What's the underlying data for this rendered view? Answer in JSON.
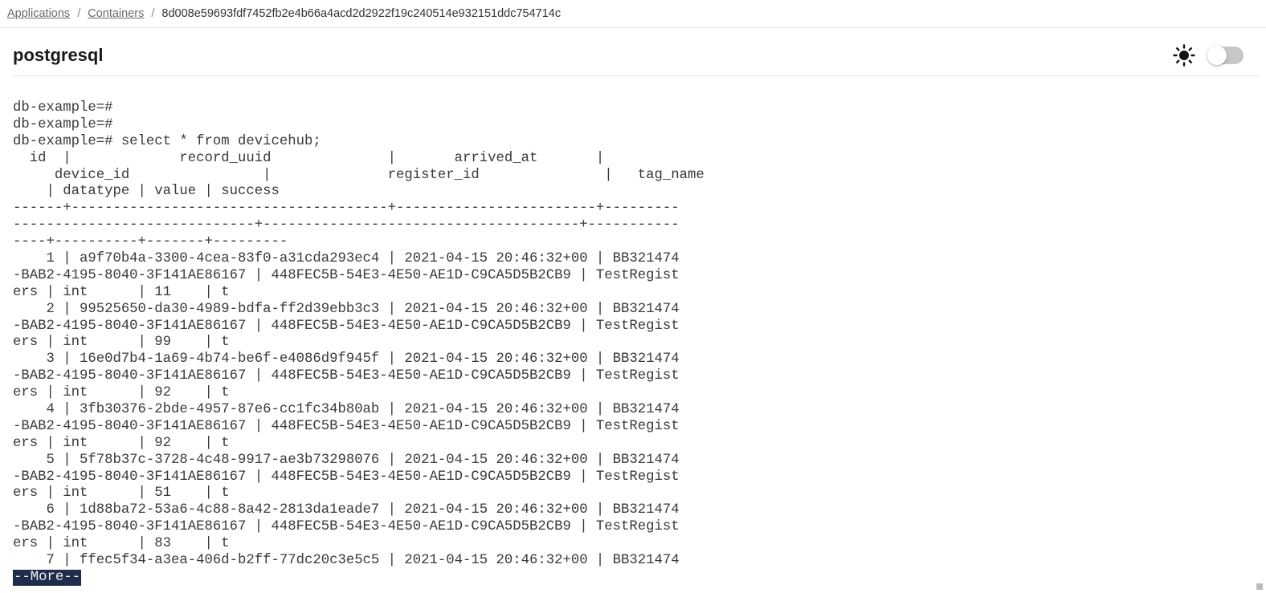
{
  "breadcrumb": {
    "items": [
      {
        "label": "Applications"
      },
      {
        "label": "Containers"
      }
    ],
    "current": "8d008e59693fdf7452fb2e4b66a4acd2d2922f19c240514e932151ddc754714c",
    "separator": "/"
  },
  "header": {
    "title": "postgresql",
    "theme_icon": "sun-icon",
    "theme_toggle_on": false
  },
  "terminal": {
    "lines": [
      "db-example=#",
      "db-example=#",
      "db-example=# select * from devicehub;",
      "  id  |             record_uuid              |       arrived_at       |",
      "     device_id                |              register_id               |   tag_name",
      "    | datatype | value | success",
      "------+--------------------------------------+------------------------+---------",
      "-----------------------------+--------------------------------------+-----------",
      "----+----------+-------+---------",
      "    1 | a9f70b4a-3300-4cea-83f0-a31cda293ec4 | 2021-04-15 20:46:32+00 | BB321474",
      "-BAB2-4195-8040-3F141AE86167 | 448FEC5B-54E3-4E50-AE1D-C9CA5D5B2CB9 | TestRegist",
      "ers | int      | 11    | t",
      "    2 | 99525650-da30-4989-bdfa-ff2d39ebb3c3 | 2021-04-15 20:46:32+00 | BB321474",
      "-BAB2-4195-8040-3F141AE86167 | 448FEC5B-54E3-4E50-AE1D-C9CA5D5B2CB9 | TestRegist",
      "ers | int      | 99    | t",
      "    3 | 16e0d7b4-1a69-4b74-be6f-e4086d9f945f | 2021-04-15 20:46:32+00 | BB321474",
      "-BAB2-4195-8040-3F141AE86167 | 448FEC5B-54E3-4E50-AE1D-C9CA5D5B2CB9 | TestRegist",
      "ers | int      | 92    | t",
      "    4 | 3fb30376-2bde-4957-87e6-cc1fc34b80ab | 2021-04-15 20:46:32+00 | BB321474",
      "-BAB2-4195-8040-3F141AE86167 | 448FEC5B-54E3-4E50-AE1D-C9CA5D5B2CB9 | TestRegist",
      "ers | int      | 92    | t",
      "    5 | 5f78b37c-3728-4c48-9917-ae3b73298076 | 2021-04-15 20:46:32+00 | BB321474",
      "-BAB2-4195-8040-3F141AE86167 | 448FEC5B-54E3-4E50-AE1D-C9CA5D5B2CB9 | TestRegist",
      "ers | int      | 51    | t",
      "    6 | 1d88ba72-53a6-4c88-8a42-2813da1eade7 | 2021-04-15 20:46:32+00 | BB321474",
      "-BAB2-4195-8040-3F141AE86167 | 448FEC5B-54E3-4E50-AE1D-C9CA5D5B2CB9 | TestRegist",
      "ers | int      | 83    | t",
      "    7 | ffec5f34-a3ea-406d-b2ff-77dc20c3e5c5 | 2021-04-15 20:46:32+00 | BB321474"
    ],
    "more_prompt": "--More--"
  }
}
